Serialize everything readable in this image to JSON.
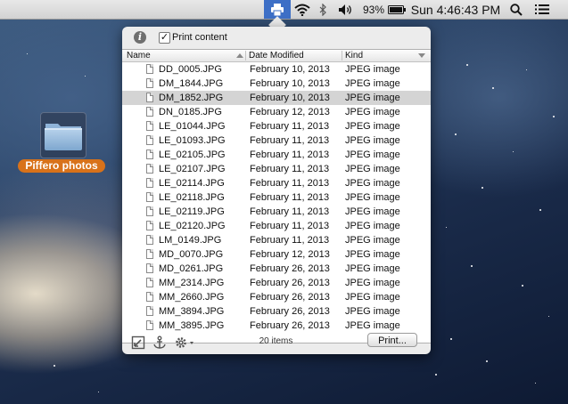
{
  "menubar": {
    "battery": "93%",
    "clock": "Sun 4:46:43 PM"
  },
  "desktop": {
    "folder_label": "Piffero photos"
  },
  "popover": {
    "print_content_label": "Print content",
    "print_content_checked": true,
    "columns": {
      "name": "Name",
      "date": "Date Modified",
      "kind": "Kind"
    },
    "rows": [
      {
        "name": "DD_0005.JPG",
        "date": "February 10, 2013",
        "kind": "JPEG image"
      },
      {
        "name": "DM_1844.JPG",
        "date": "February 10, 2013",
        "kind": "JPEG image"
      },
      {
        "name": "DM_1852.JPG",
        "date": "February 10, 2013",
        "kind": "JPEG image"
      },
      {
        "name": "DN_0185.JPG",
        "date": "February 12, 2013",
        "kind": "JPEG image"
      },
      {
        "name": "LE_01044.JPG",
        "date": "February 11, 2013",
        "kind": "JPEG image"
      },
      {
        "name": "LE_01093.JPG",
        "date": "February 11, 2013",
        "kind": "JPEG image"
      },
      {
        "name": "LE_02105.JPG",
        "date": "February 11, 2013",
        "kind": "JPEG image"
      },
      {
        "name": "LE_02107.JPG",
        "date": "February 11, 2013",
        "kind": "JPEG image"
      },
      {
        "name": "LE_02114.JPG",
        "date": "February 11, 2013",
        "kind": "JPEG image"
      },
      {
        "name": "LE_02118.JPG",
        "date": "February 11, 2013",
        "kind": "JPEG image"
      },
      {
        "name": "LE_02119.JPG",
        "date": "February 11, 2013",
        "kind": "JPEG image"
      },
      {
        "name": "LE_02120.JPG",
        "date": "February 11, 2013",
        "kind": "JPEG image"
      },
      {
        "name": "LM_0149.JPG",
        "date": "February 11, 2013",
        "kind": "JPEG image"
      },
      {
        "name": "MD_0070.JPG",
        "date": "February 12, 2013",
        "kind": "JPEG image"
      },
      {
        "name": "MD_0261.JPG",
        "date": "February 26, 2013",
        "kind": "JPEG image"
      },
      {
        "name": "MM_2314.JPG",
        "date": "February 26, 2013",
        "kind": "JPEG image"
      },
      {
        "name": "MM_2660.JPG",
        "date": "February 26, 2013",
        "kind": "JPEG image"
      },
      {
        "name": "MM_3894.JPG",
        "date": "February 26, 2013",
        "kind": "JPEG image"
      },
      {
        "name": "MM_3895.JPG",
        "date": "February 26, 2013",
        "kind": "JPEG image"
      }
    ],
    "selected_row": 2,
    "item_count": "20 items",
    "print_button": "Print..."
  },
  "icons": {
    "menubar": [
      "printer-icon",
      "wifi-icon",
      "bluetooth-icon",
      "volume-icon",
      "battery-icon",
      "search-icon",
      "list-icon"
    ],
    "footer": [
      "reveal-icon",
      "anchor-icon",
      "gear-icon"
    ],
    "info": "info-icon"
  },
  "colors": {
    "selection": "#d4d4d4",
    "folder_label_bg": "#d8721a",
    "menubar_highlight": "#3d6fc6"
  }
}
